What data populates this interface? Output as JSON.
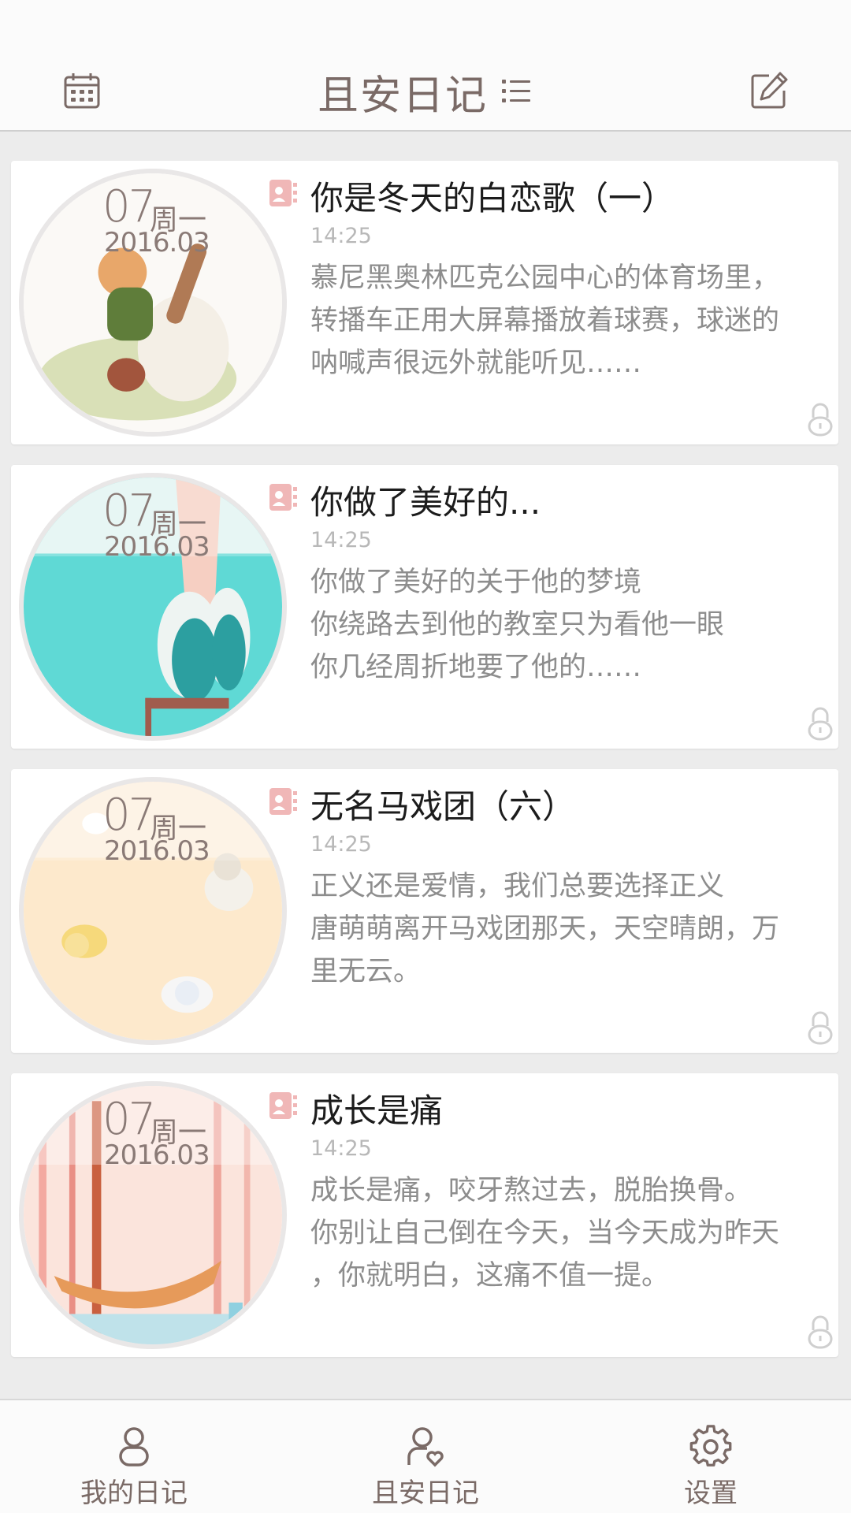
{
  "app": {
    "title": "且安日记"
  },
  "colors": {
    "accent": "#7a6a66",
    "tag": "#f0b7b7",
    "background": "#ececec"
  },
  "diaries": [
    {
      "day": "07",
      "weekday": "周一",
      "year_month": "2016.03",
      "title": "你是冬天的白恋歌（一）",
      "time": "14:25",
      "body": [
        "慕尼黑奥林匹克公园中心的体育场里，",
        "转播车正用大屏幕播放着球赛，球迷的",
        "呐喊声很远外就能听见……"
      ]
    },
    {
      "day": "07",
      "weekday": "周一",
      "year_month": "2016.03",
      "title": "你做了美好的...",
      "time": "14:25",
      "body": [
        "你做了美好的关于他的梦境",
        "你绕路去到他的教室只为看他一眼",
        "你几经周折地要了他的……"
      ]
    },
    {
      "day": "07",
      "weekday": "周一",
      "year_month": "2016.03",
      "title": "无名马戏团（六）",
      "time": "14:25",
      "body": [
        "正义还是爱情，我们总要选择正义",
        "唐萌萌离开马戏团那天，天空晴朗，万",
        "里无云。"
      ]
    },
    {
      "day": "07",
      "weekday": "周一",
      "year_month": "2016.03",
      "title": "成长是痛",
      "time": "14:25",
      "body": [
        "成长是痛，咬牙熬过去，脱胎换骨。",
        "你别让自己倒在今天，当今天成为昨天",
        "，你就明白，这痛不值一提。"
      ]
    }
  ],
  "bottom_nav": {
    "items": [
      {
        "label": "我的日记",
        "icon": "person-icon"
      },
      {
        "label": "且安日记",
        "icon": "person-heart-icon"
      },
      {
        "label": "设置",
        "icon": "gear-icon"
      }
    ]
  }
}
